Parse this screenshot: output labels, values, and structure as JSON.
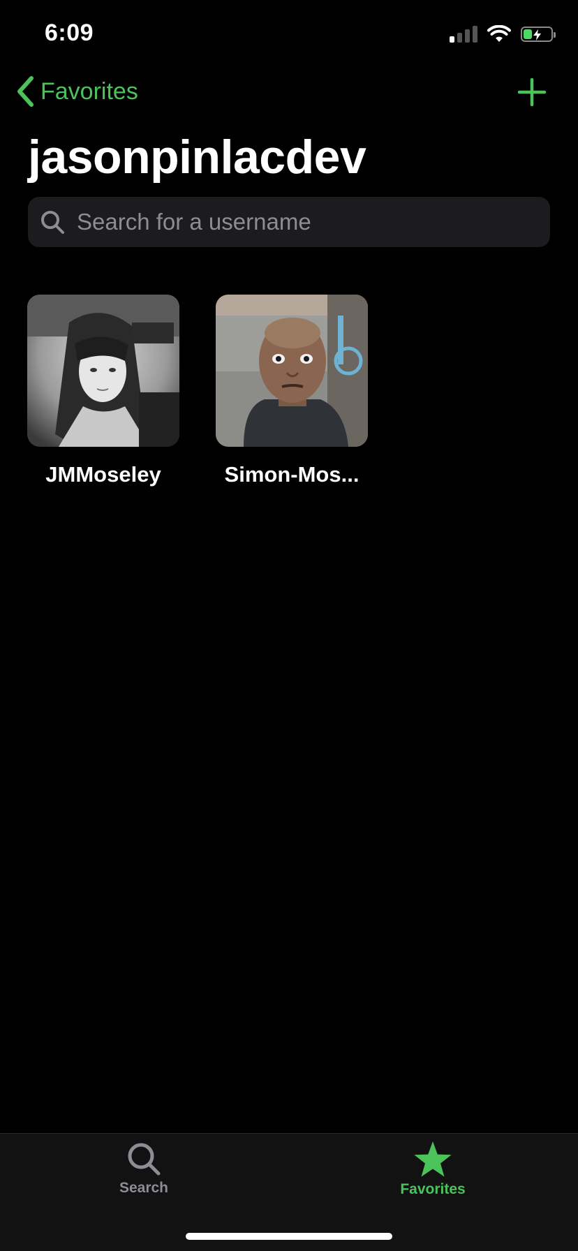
{
  "status_bar": {
    "time": "6:09"
  },
  "nav": {
    "back_label": "Favorites",
    "title": "jasonpinlacdev"
  },
  "search": {
    "placeholder": "Search for a username"
  },
  "favorites": [
    {
      "username": "JMMoseley"
    },
    {
      "username": "Simon-Mos..."
    }
  ],
  "tab_bar": {
    "tabs": [
      {
        "label": "Search",
        "icon": "magnifying-glass-icon",
        "selected": false
      },
      {
        "label": "Favorites",
        "icon": "star-icon",
        "selected": true
      }
    ]
  },
  "colors": {
    "accent": "#4cc35a",
    "background": "#000000",
    "search_field": "#1c1c1e",
    "inactive": "#8d8d93"
  }
}
